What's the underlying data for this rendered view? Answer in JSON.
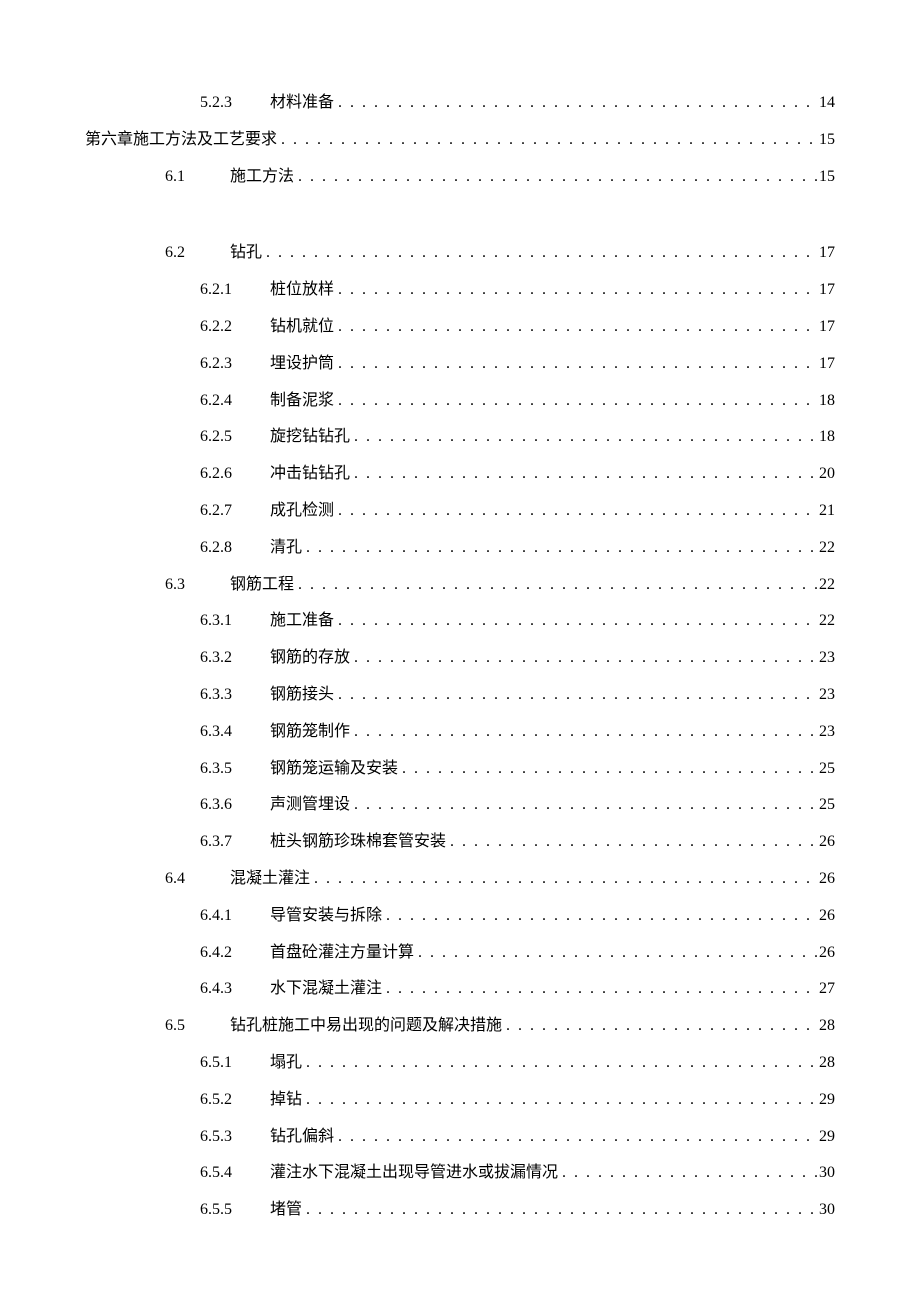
{
  "toc": [
    {
      "indent": 2,
      "num": "5.2.3",
      "title": "材料准备",
      "page": "14"
    },
    {
      "indent": 0,
      "num": "",
      "title": "第六章施工方法及工艺要求",
      "page": "15",
      "chapter": true
    },
    {
      "indent": 1,
      "num": "6.1",
      "title": "施工方法",
      "page": "15"
    },
    {
      "spacer": true
    },
    {
      "indent": 1,
      "num": "6.2",
      "title": "钻孔",
      "page": "17"
    },
    {
      "indent": 2,
      "num": "6.2.1",
      "title": "桩位放样",
      "page": "17"
    },
    {
      "indent": 2,
      "num": "6.2.2",
      "title": "钻机就位",
      "page": "17"
    },
    {
      "indent": 2,
      "num": "6.2.3",
      "title": "埋设护筒",
      "page": "17"
    },
    {
      "indent": 2,
      "num": "6.2.4",
      "title": "制备泥浆",
      "page": "18"
    },
    {
      "indent": 2,
      "num": "6.2.5",
      "title": "旋挖钻钻孔",
      "page": "18"
    },
    {
      "indent": 2,
      "num": "6.2.6",
      "title": "冲击钻钻孔",
      "page": "20"
    },
    {
      "indent": 2,
      "num": "6.2.7",
      "title": "成孔检测",
      "page": "21"
    },
    {
      "indent": 2,
      "num": "6.2.8",
      "title": "清孔",
      "page": "22"
    },
    {
      "indent": 1,
      "num": "6.3",
      "title": "钢筋工程",
      "page": "22"
    },
    {
      "indent": 2,
      "num": "6.3.1",
      "title": "施工准备",
      "page": "22"
    },
    {
      "indent": 2,
      "num": "6.3.2",
      "title": "钢筋的存放",
      "page": "23"
    },
    {
      "indent": 2,
      "num": "6.3.3",
      "title": "钢筋接头",
      "page": "23"
    },
    {
      "indent": 2,
      "num": "6.3.4",
      "title": "钢筋笼制作",
      "page": "23"
    },
    {
      "indent": 2,
      "num": "6.3.5",
      "title": "钢筋笼运输及安装",
      "page": "25"
    },
    {
      "indent": 2,
      "num": "6.3.6",
      "title": "声测管埋设",
      "page": "25"
    },
    {
      "indent": 2,
      "num": "6.3.7",
      "title": "桩头钢筋珍珠棉套管安装",
      "page": "26"
    },
    {
      "indent": 1,
      "num": "6.4",
      "title": "混凝土灌注",
      "page": "26"
    },
    {
      "indent": 2,
      "num": "6.4.1",
      "title": "导管安装与拆除",
      "page": "26"
    },
    {
      "indent": 2,
      "num": "6.4.2",
      "title": "首盘砼灌注方量计算",
      "page": "26"
    },
    {
      "indent": 2,
      "num": "6.4.3",
      "title": "水下混凝土灌注",
      "page": "27"
    },
    {
      "indent": 1,
      "num": "6.5",
      "title": "钻孔桩施工中易出现的问题及解决措施",
      "page": "28"
    },
    {
      "indent": 2,
      "num": "6.5.1",
      "title": "塌孔",
      "page": "28"
    },
    {
      "indent": 2,
      "num": "6.5.2",
      "title": "掉钻",
      "page": "29"
    },
    {
      "indent": 2,
      "num": "6.5.3",
      "title": "钻孔偏斜",
      "page": "29"
    },
    {
      "indent": 2,
      "num": "6.5.4",
      "title": "灌注水下混凝土出现导管进水或拔漏情况",
      "page": "30"
    },
    {
      "indent": 2,
      "num": "6.5.5",
      "title": "堵管",
      "page": "30"
    }
  ]
}
